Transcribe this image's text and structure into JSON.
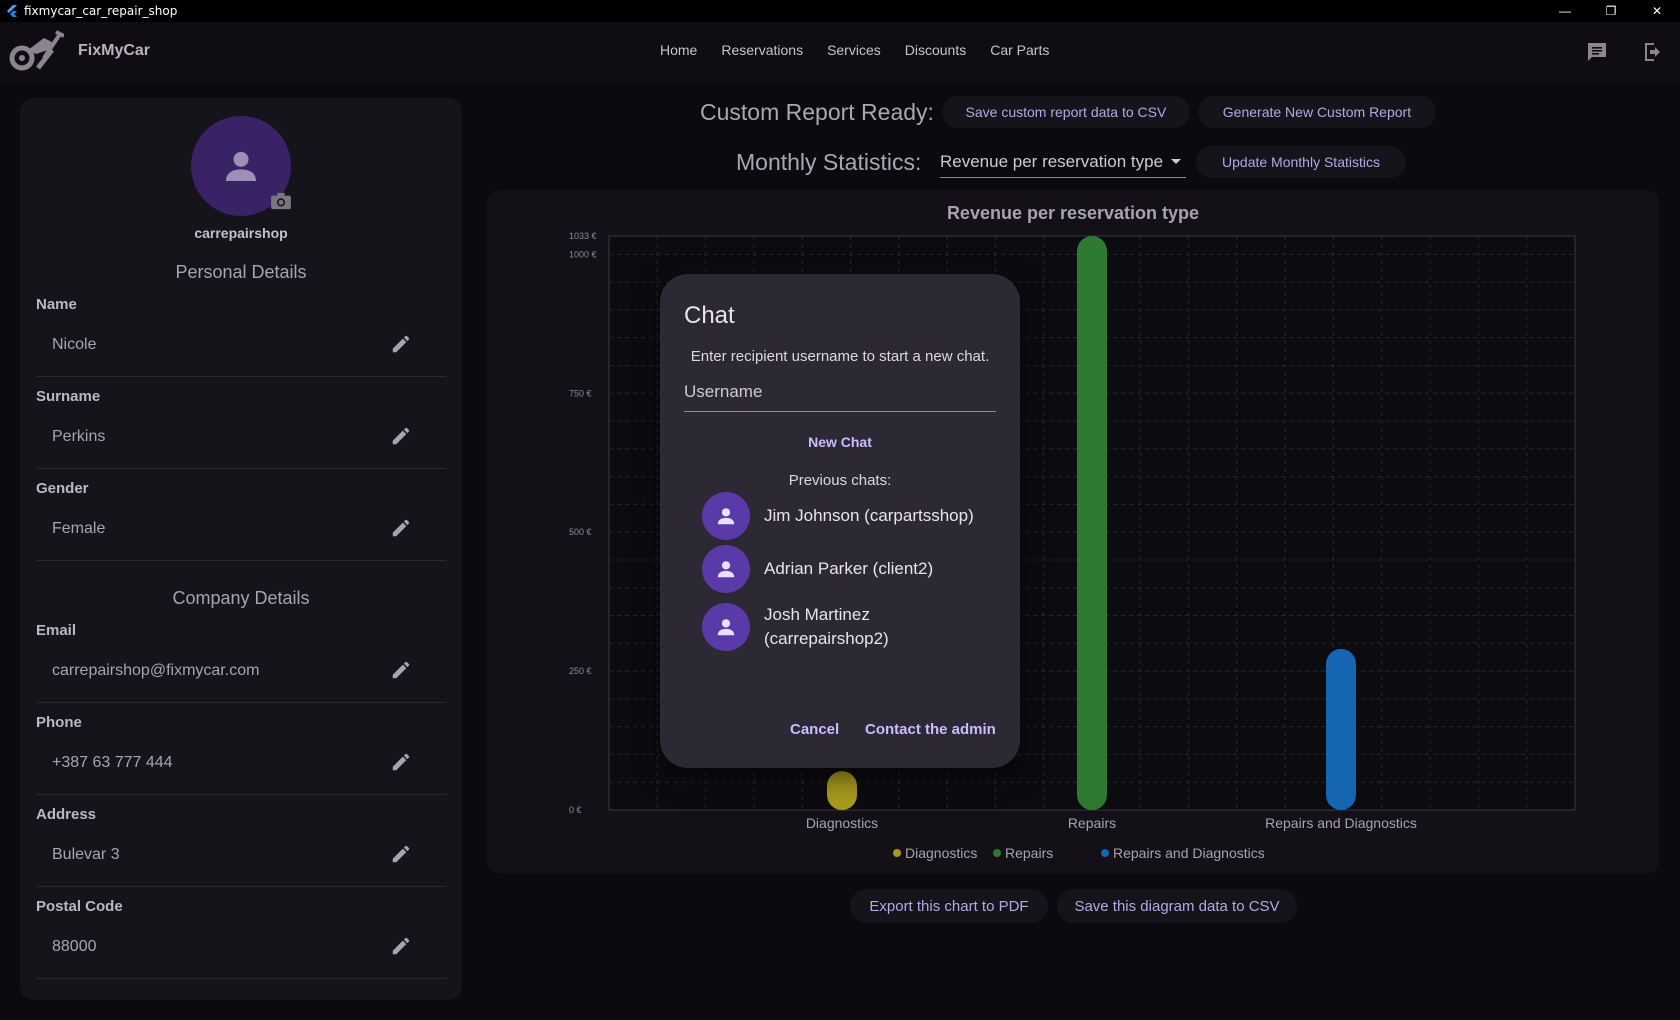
{
  "window": {
    "title": "fixmycar_car_repair_shop"
  },
  "appbar": {
    "brand": "FixMyCar",
    "nav": [
      "Home",
      "Reservations",
      "Services",
      "Discounts",
      "Car Parts"
    ]
  },
  "profile": {
    "username": "carrepairshop",
    "personal_heading": "Personal Details",
    "company_heading": "Company Details",
    "fields": [
      {
        "label": "Name",
        "value": "Nicole"
      },
      {
        "label": "Surname",
        "value": "Perkins"
      },
      {
        "label": "Gender",
        "value": "Female"
      },
      {
        "label": "Email",
        "value": "carrepairshop@fixmycar.com"
      },
      {
        "label": "Phone",
        "value": "+387 63 777 444"
      },
      {
        "label": "Address",
        "value": "Bulevar 3"
      },
      {
        "label": "Postal Code",
        "value": "88000"
      }
    ]
  },
  "report": {
    "custom_label": "Custom Report Ready:",
    "save_csv": "Save custom report data to CSV",
    "generate": "Generate New Custom Report",
    "monthly_label": "Monthly Statistics:",
    "monthly_select": "Revenue per reservation type",
    "update": "Update Monthly Statistics"
  },
  "chart_data": {
    "type": "bar",
    "title": "Revenue per reservation type",
    "categories": [
      "Diagnostics",
      "Repairs",
      "Repairs and Diagnostics"
    ],
    "values": [
      70,
      1033,
      290
    ],
    "colors": [
      "#a89a1e",
      "#2f7a33",
      "#1565b0"
    ],
    "ylim": [
      0,
      1033
    ],
    "yticks": [
      {
        "v": 0,
        "label": "0 €"
      },
      {
        "v": 250,
        "label": "250 €"
      },
      {
        "v": 500,
        "label": "500 €"
      },
      {
        "v": 750,
        "label": "750 €"
      },
      {
        "v": 1000,
        "label": "1000 €"
      },
      {
        "v": 1033,
        "label": "1033 €"
      }
    ],
    "legend": [
      "Diagnostics",
      "Repairs",
      "Repairs and Diagnostics"
    ],
    "legend_position": "bottom",
    "grid": true
  },
  "bottom": {
    "export_pdf": "Export this chart to PDF",
    "save_csv": "Save this diagram data to CSV"
  },
  "dialog": {
    "title": "Chat",
    "subtitle": "Enter recipient username to start a new chat.",
    "placeholder": "Username",
    "new_chat": "New Chat",
    "previous": "Previous chats:",
    "chats": [
      "Jim Johnson (carpartsshop)",
      "Adrian Parker (client2)",
      "Josh Martinez (carrepairshop2)"
    ],
    "cancel": "Cancel",
    "contact_admin": "Contact the admin"
  }
}
